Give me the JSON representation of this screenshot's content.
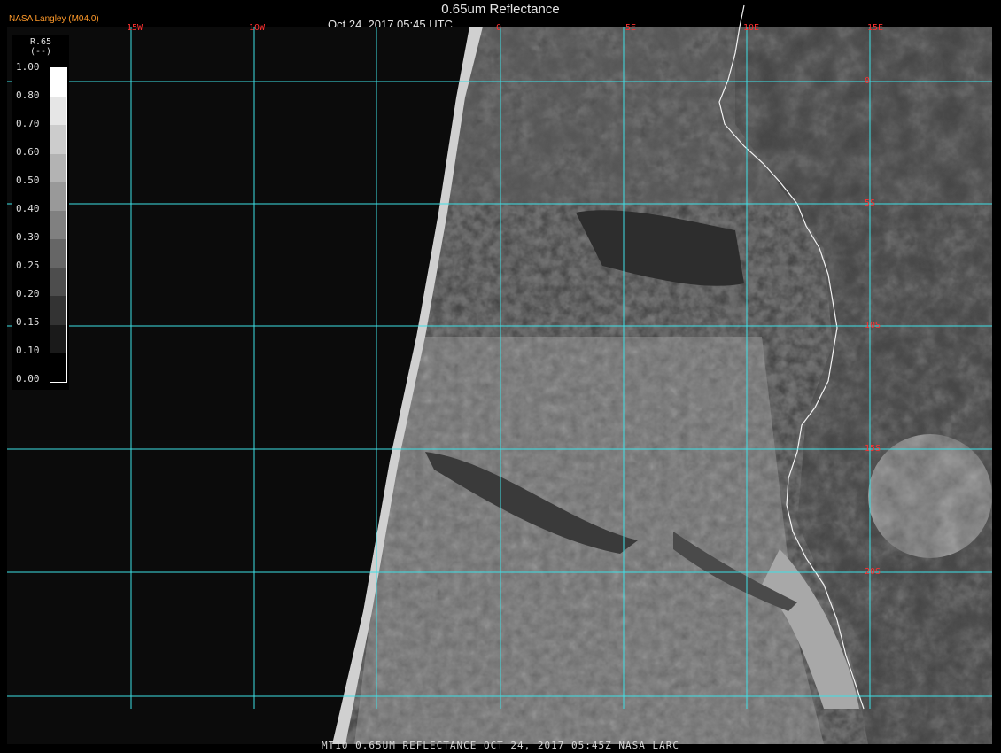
{
  "header": {
    "credit": "NASA Langley (M04.0)",
    "title": "0.65um Reflectance",
    "subtitle": "Oct 24, 2017 05:45 UTC"
  },
  "legend": {
    "title_line1": "R.65",
    "title_line2": "(--)",
    "unit_mark": "(%)",
    "ticks": [
      "1.00",
      "0.80",
      "0.70",
      "0.60",
      "0.50",
      "0.40",
      "0.30",
      "0.25",
      "0.20",
      "0.15",
      "0.10",
      "0.00"
    ]
  },
  "grid": {
    "color": "#3ee0e6",
    "label_color": "#ff3030",
    "longitude_labels": [
      "15W",
      "10W",
      "0",
      "5E",
      "10E",
      "15E"
    ],
    "latitude_labels": [
      "0",
      "5S",
      "10S",
      "15S",
      "20S"
    ]
  },
  "footer": {
    "caption": "MT10  0.65UM REFLECTANCE   OCT 24, 2017 05:45Z   NASA LARC"
  }
}
